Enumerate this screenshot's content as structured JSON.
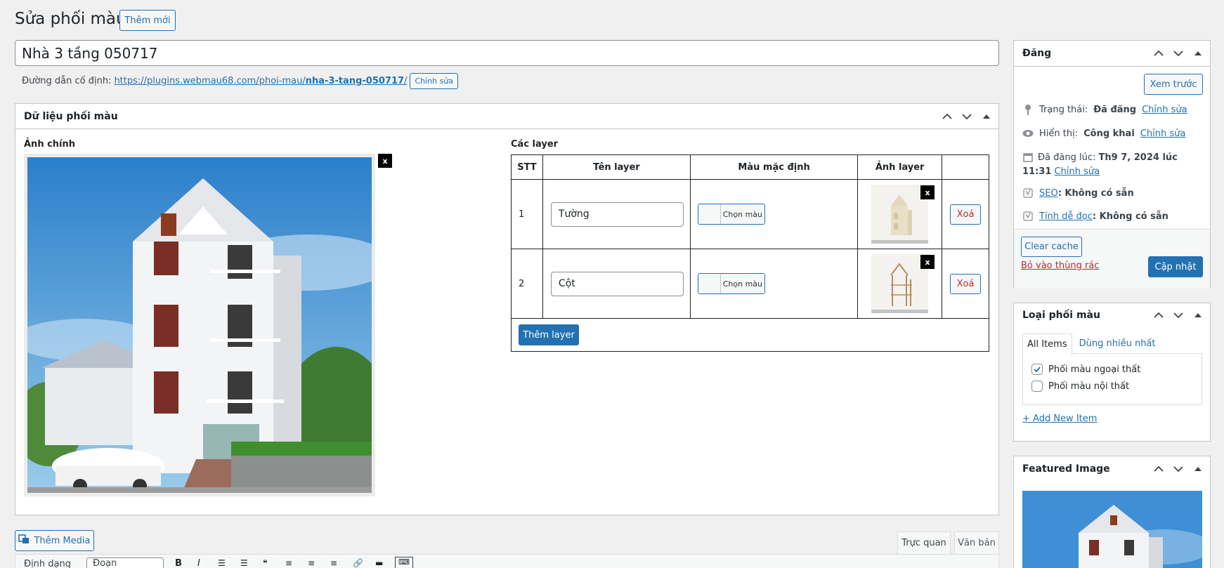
{
  "page": {
    "title": "Sửa phối màu",
    "add_new": "Thêm mới"
  },
  "post": {
    "title": "Nhà 3 tầng 050717",
    "permalink_label": "Đường dẫn cố định:",
    "permalink_base": "https://plugins.webmau68.com/phoi-mau/",
    "permalink_slug": "nha-3-tang-050717",
    "permalink_trailing": "/",
    "permalink_edit": "Chỉnh sửa"
  },
  "metabox": {
    "title": "Dữ liệu phối màu",
    "main_image_label": "Ảnh chính",
    "remove_label": "x",
    "layers_label": "Các layer",
    "columns": [
      "STT",
      "Tên layer",
      "Màu mặc định",
      "Ảnh layer",
      ""
    ],
    "rows": [
      {
        "stt": "1",
        "name": "Tường",
        "color_label": "Chọn màu",
        "remove": "x",
        "delete": "Xoá"
      },
      {
        "stt": "2",
        "name": "Cột",
        "color_label": "Chọn màu",
        "remove": "x",
        "delete": "Xoá"
      }
    ],
    "add_layer": "Thêm layer"
  },
  "publish": {
    "title": "Đăng",
    "preview": "Xem trước",
    "status_label": "Trạng thái:",
    "status_value": "Đã đăng",
    "visibility_label": "Hiển thị:",
    "visibility_value": "Công khai",
    "published_label": "Đã đăng lúc:",
    "published_value": "Th9 7, 2024 lúc 11:31",
    "edit": "Chỉnh sửa",
    "seo_label": "SEO",
    "seo_value": ": Không có sẵn",
    "readability_label": "Tính dễ đọc",
    "readability_value": ": Không có sẵn",
    "clear_cache": "Clear cache",
    "trash": "Bỏ vào thùng rác",
    "update": "Cập nhật"
  },
  "taxonomy": {
    "title": "Loại phối màu",
    "tabs": [
      "All Items",
      "Dùng nhiều nhất"
    ],
    "items": [
      {
        "label": "Phối màu ngoại thất",
        "checked": true
      },
      {
        "label": "Phối màu nội thất",
        "checked": false
      }
    ],
    "add_new": "+ Add New Item"
  },
  "featured": {
    "title": "Featured Image"
  },
  "editor": {
    "add_media": "Thêm Media",
    "tab_visual": "Trực quan",
    "tab_text": "Văn bản",
    "format_label": "Định dạng",
    "format_value": "Đoạn"
  },
  "colors": {
    "accent": "#2271b1",
    "danger": "#b32d2e",
    "sky": "#4b9bd6"
  },
  "icons": {
    "collapse_up": "chevron-up-icon",
    "collapse_down": "chevron-down-icon",
    "toggle": "triangle-up-icon",
    "status": "pin-icon",
    "visibility": "eye-icon",
    "calendar": "calendar-icon",
    "yoast": "yoast-icon",
    "media": "media-icon"
  }
}
